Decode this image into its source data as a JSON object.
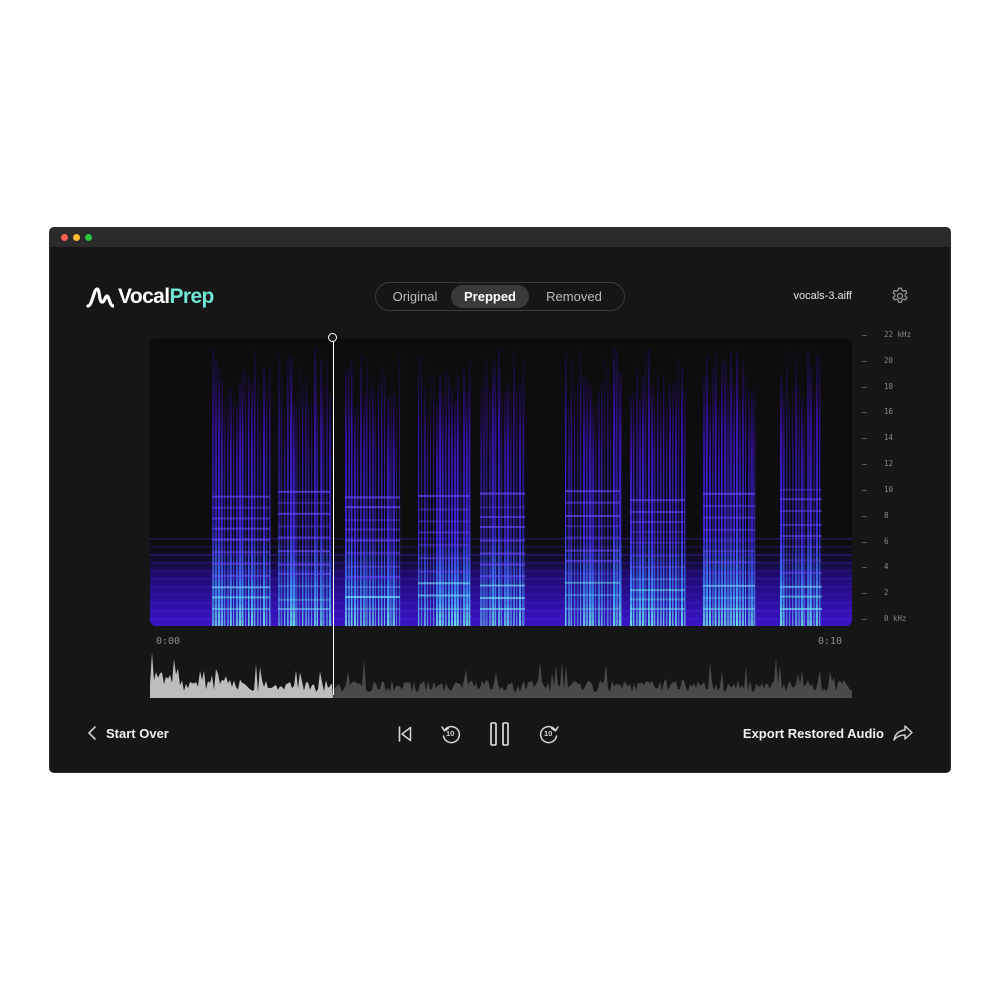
{
  "app": {
    "name_part1": "Vocal",
    "name_part2": "Prep"
  },
  "view_tabs": [
    {
      "label": "Original",
      "selected": false
    },
    {
      "label": "Prepped",
      "selected": true
    },
    {
      "label": "Removed",
      "selected": false
    }
  ],
  "file": {
    "name": "vocals-3.aiff"
  },
  "frequency_axis": {
    "ticks": [
      "22 kHz",
      "20",
      "18",
      "16",
      "14",
      "12",
      "10",
      "8",
      "6",
      "4",
      "2",
      "0 kHz"
    ]
  },
  "timeline": {
    "start": "0:00",
    "end": "0:10"
  },
  "footer": {
    "start_over_label": "Start Over",
    "export_label": "Export Restored Audio"
  },
  "transport": {
    "skip_back_amount": "10",
    "skip_forward_amount": "10",
    "state": "playing"
  },
  "colors": {
    "accent": "#6fe6d6",
    "background": "#161616",
    "spectrogram_low": "#3a10c8",
    "spectrogram_high": "#5ef0e0"
  },
  "icons": {
    "logo": "vocalprep-logo-mark",
    "settings": "gear-icon",
    "back": "chevron-left-icon",
    "skip_start": "skip-to-start-icon",
    "rewind": "rewind-10-icon",
    "pause": "pause-icon",
    "forward": "forward-10-icon",
    "export": "share-arrow-icon"
  }
}
